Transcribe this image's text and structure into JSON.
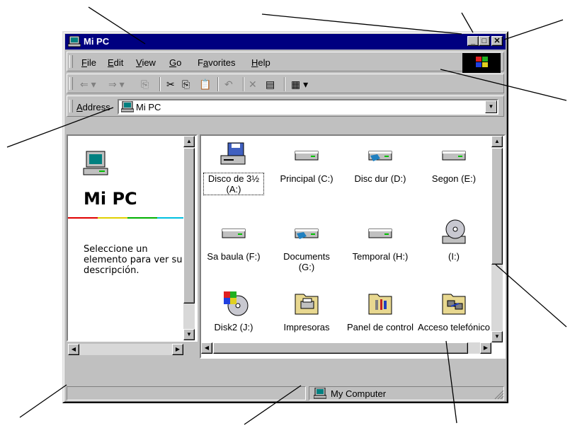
{
  "window": {
    "title": "Mi PC"
  },
  "menu": {
    "items": [
      {
        "pre": "",
        "u": "F",
        "post": "ile"
      },
      {
        "pre": "",
        "u": "E",
        "post": "dit"
      },
      {
        "pre": "",
        "u": "V",
        "post": "iew"
      },
      {
        "pre": "",
        "u": "G",
        "post": "o"
      },
      {
        "pre": "F",
        "u": "a",
        "post": "vorites"
      },
      {
        "pre": "",
        "u": "H",
        "post": "elp"
      }
    ]
  },
  "address": {
    "label_u": "A",
    "label_rest": "ddress",
    "value": "Mi PC"
  },
  "leftpane": {
    "title": "Mi PC",
    "description": "Seleccione un elemento para ver su descripción."
  },
  "items": [
    {
      "label": "Disco de 3½ (A:)",
      "icon": "floppy-drive-icon",
      "selected": true
    },
    {
      "label": "Principal (C:)",
      "icon": "hard-drive-icon"
    },
    {
      "label": "Disc dur (D:)",
      "icon": "network-drive-icon"
    },
    {
      "label": "Segon (E:)",
      "icon": "hard-drive-icon"
    },
    {
      "label": "Sa baula (F:)",
      "icon": "hard-drive-icon"
    },
    {
      "label": "Documents (G:)",
      "icon": "network-drive-icon"
    },
    {
      "label": "Temporal (H:)",
      "icon": "hard-drive-icon"
    },
    {
      "label": "(I:)",
      "icon": "cd-drive-icon"
    },
    {
      "label": "Disk2 (J:)",
      "icon": "removable-disk-icon"
    },
    {
      "label": "Impresoras",
      "icon": "printers-folder-icon"
    },
    {
      "label": "Panel de control",
      "icon": "control-panel-folder-icon"
    },
    {
      "label": "Acceso telefónico",
      "icon": "dialup-folder-icon"
    }
  ],
  "status": {
    "text": "My Computer"
  }
}
